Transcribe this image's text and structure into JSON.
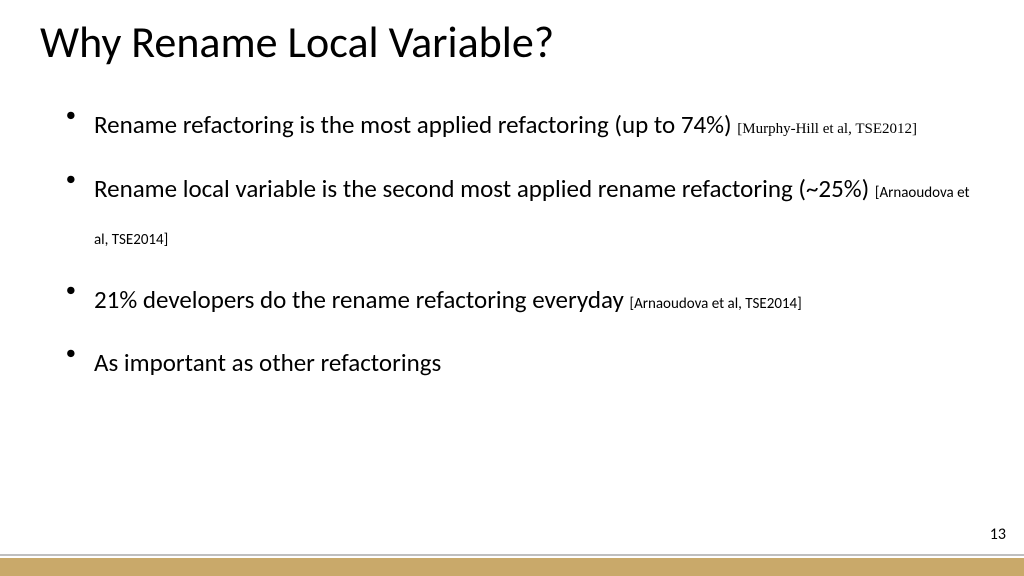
{
  "title": "Why Rename Local Variable?",
  "bullets": [
    {
      "text": "Rename refactoring is the most applied refactoring (up to 74%) ",
      "citation": "[Murphy-Hill et al, TSE2012]",
      "citationStyle": "serif"
    },
    {
      "text": "Rename local variable is the second most applied rename refactoring (~25%) ",
      "citation": "[Arnaoudova et al, TSE2014]",
      "citationStyle": "sans"
    },
    {
      "text": "21% developers do the rename refactoring everyday ",
      "citation": "[Arnaoudova et al, TSE2014]",
      "citationStyle": "sans"
    },
    {
      "text": "As important as other refactorings",
      "citation": "",
      "citationStyle": ""
    }
  ],
  "pageNumber": "13"
}
